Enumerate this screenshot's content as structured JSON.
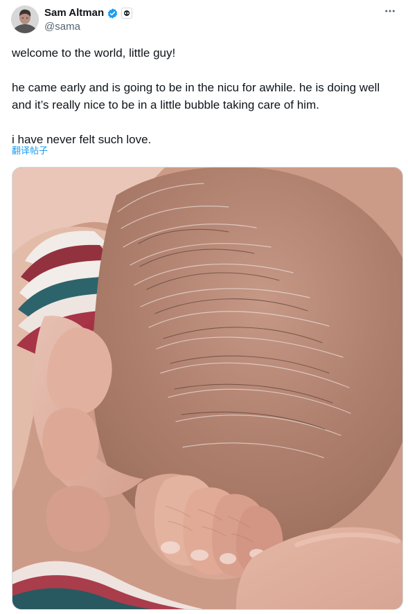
{
  "user": {
    "display_name": "Sam Altman",
    "handle": "@sama",
    "verified": true,
    "avatar_icon": "profile-photo",
    "verified_icon": "verified-badge-icon",
    "affiliate_icon": "openai-logo-icon"
  },
  "actions": {
    "more_icon": "more-options-icon"
  },
  "tweet": {
    "text": "welcome to the world, little guy!\n\nhe came early and is going to be in the nicu for awhile. he is doing well and it’s really nice to be in a little bubble taking care of him.\n\ni have never felt such love.",
    "translate_label": "翻译帖子"
  },
  "colors": {
    "accent": "#1d9bf0",
    "text": "#0f1419",
    "secondary": "#536471",
    "border": "#cfd9de"
  }
}
